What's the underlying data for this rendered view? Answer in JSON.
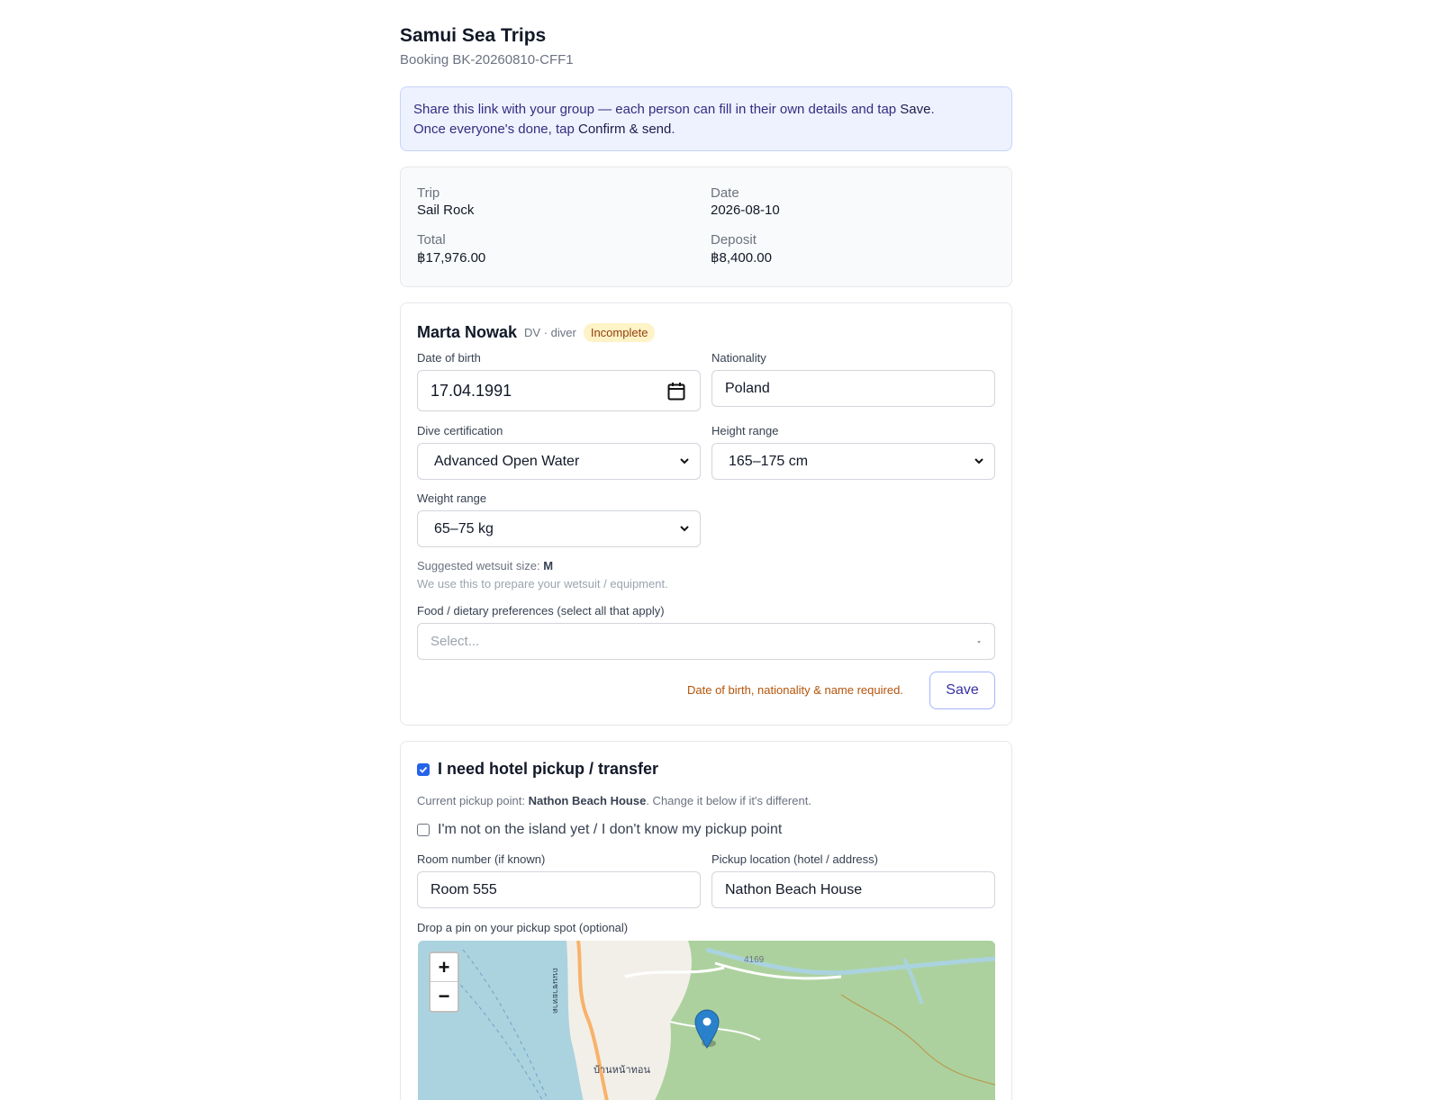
{
  "header": {
    "shop_name": "Samui Sea Trips",
    "booking_ref": "Booking BK-20260810-CFF1"
  },
  "banner": {
    "text_1": "Share this link with your group — each person can fill in their own details and tap ",
    "save_word": "Save",
    "text_2": ".",
    "text_3": "Once everyone's done, tap ",
    "confirm_word": "Confirm & send",
    "text_4": "."
  },
  "summary": {
    "trip_label": "Trip",
    "trip_value": "Sail Rock",
    "date_label": "Date",
    "date_value": "2026-08-10",
    "total_label": "Total",
    "total_value": "฿17,976.00",
    "deposit_label": "Deposit",
    "deposit_value": "฿8,400.00"
  },
  "person": {
    "name": "Marta Nowak",
    "meta": "DV · diver",
    "status": "Incomplete",
    "dob_label": "Date of birth",
    "dob_value": "17.04.1991",
    "nationality_label": "Nationality",
    "nationality_value": "Poland",
    "cert_label": "Dive certification",
    "cert_value": "Advanced Open Water",
    "height_label": "Height range",
    "height_value": "165–175 cm",
    "weight_label": "Weight range",
    "weight_value": "65–75 kg",
    "wetsuit_prefix": "Suggested wetsuit size: ",
    "wetsuit_size": "M",
    "wetsuit_note": "We use this to prepare your wetsuit / equipment.",
    "food_label": "Food / dietary preferences (select all that apply)",
    "food_placeholder": "Select...",
    "warning": "Date of birth, nationality & name required.",
    "save_label": "Save"
  },
  "pickup": {
    "needs_pickup": true,
    "title": "I need hotel pickup / transfer",
    "current_prefix": "Current pickup point: ",
    "current_point": "Nathon Beach House",
    "current_suffix": ". Change it below if it's different.",
    "not_on_island_checked": false,
    "not_on_island_label": "I'm not on the island yet / I don't know my pickup point",
    "room_label": "Room number (if known)",
    "room_value": "Room 555",
    "location_label": "Pickup location (hotel / address)",
    "location_value": "Nathon Beach House",
    "pin_label": "Drop a pin on your pickup spot (optional)",
    "zoom_in": "+",
    "zoom_out": "−",
    "map_road_label": "4169",
    "map_place_label": "บ้านหน้าทอน",
    "map_street_label": "ถนนชายหาด",
    "colors": {
      "water": "#aad3df",
      "forest": "#add19e",
      "marker": "#2a81cb"
    }
  }
}
